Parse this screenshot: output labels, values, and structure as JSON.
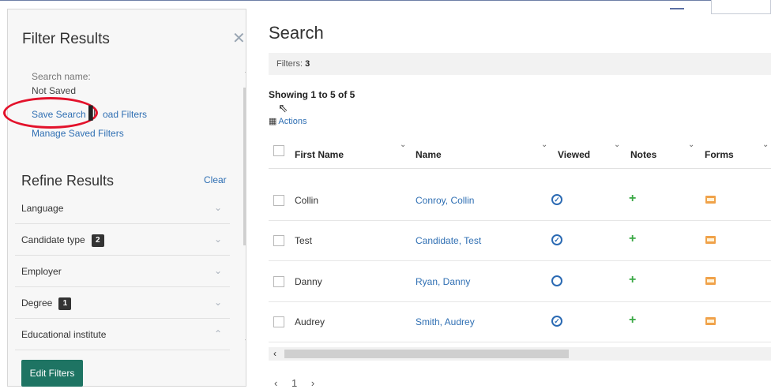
{
  "filter_panel": {
    "title": "Filter Results",
    "close_icon": "close-icon",
    "search_name_label": "Search name:",
    "search_name_value": "Not Saved",
    "save_search": "Save Search",
    "separator": "|",
    "load_filters": "oad Filters",
    "manage_saved_filters": "Manage Saved Filters",
    "refine_title": "Refine Results",
    "clear": "Clear",
    "filters": [
      {
        "label": "Language",
        "badge": null,
        "expanded": false
      },
      {
        "label": "Candidate type",
        "badge": "2",
        "expanded": false
      },
      {
        "label": "Employer",
        "badge": null,
        "expanded": false
      },
      {
        "label": "Degree",
        "badge": "1",
        "expanded": false
      },
      {
        "label": "Educational institute",
        "badge": null,
        "expanded": true
      }
    ],
    "edit_filters": "Edit Filters",
    "highlight_color": "#e3122b"
  },
  "main": {
    "title": "Search",
    "filters_label": "Filters:",
    "filters_count": "3",
    "showing": "Showing 1 to 5 of 5",
    "actions": "Actions",
    "columns": [
      "First Name",
      "Name",
      "Viewed",
      "Notes",
      "Forms"
    ],
    "rows": [
      {
        "first_name": "Collin",
        "name": "Conroy, Collin",
        "viewed": true
      },
      {
        "first_name": "Test",
        "name": "Candidate, Test",
        "viewed": true
      },
      {
        "first_name": "Danny",
        "name": "Ryan, Danny",
        "viewed": false
      },
      {
        "first_name": "Audrey",
        "name": "Smith, Audrey",
        "viewed": true
      }
    ],
    "pager": {
      "prev": "‹",
      "page": "1",
      "next": "›"
    }
  },
  "colors": {
    "link": "#2f6fb3",
    "button": "#1e7463",
    "notes_plus": "#3aa845",
    "forms_icon": "#f0a24a",
    "viewed_icon": "#2b6ab3"
  }
}
